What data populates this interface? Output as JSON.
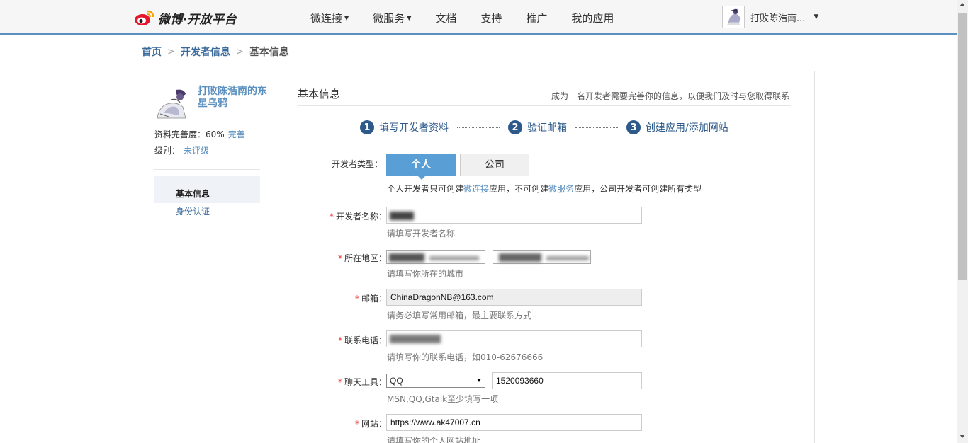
{
  "header": {
    "logo_text": "微博·开放平台",
    "nav": [
      {
        "label": "微连接",
        "dropdown": true
      },
      {
        "label": "微服务",
        "dropdown": true
      },
      {
        "label": "文档",
        "dropdown": false
      },
      {
        "label": "支持",
        "dropdown": false
      },
      {
        "label": "推广",
        "dropdown": false
      },
      {
        "label": "我的应用",
        "dropdown": false
      }
    ],
    "user_name": "打败陈浩南..."
  },
  "breadcrumb": [
    "首页",
    "开发者信息",
    "基本信息"
  ],
  "sidebar": {
    "name": "打败陈浩南的东星乌鸦",
    "completeness_label": "资料完善度：",
    "completeness_value": "60%",
    "completeness_link": "完善",
    "level_label": "级别：",
    "level_value": "未评级",
    "menu": [
      "基本信息",
      "身份认证"
    ]
  },
  "panel": {
    "title": "基本信息",
    "tip": "成为一名开发者需要完善你的信息，以便我们及时与您取得联系",
    "steps": [
      {
        "num": "1",
        "label": "填写开发者资料"
      },
      {
        "num": "2",
        "label": "验证邮箱"
      },
      {
        "num": "3",
        "label": "创建应用/添加网站"
      }
    ]
  },
  "form": {
    "type_label": "开发者类型：",
    "type_person": "个人",
    "type_company": "公司",
    "type_hint_1": "个人开发者只可创建",
    "type_hint_link1": "微连接",
    "type_hint_2": "应用，不可创建",
    "type_hint_link2": "微服务",
    "type_hint_3": "应用，公司开发者可创建所有类型",
    "name_label": "开发者名称：",
    "name_hint": "请填写开发者名称",
    "region_label": "所在地区：",
    "region_hint": "请填写你所在的城市",
    "email_label": "邮箱：",
    "email_value": "ChinaDragonNB@163.com",
    "email_hint": "请务必填写常用邮箱，最主要联系方式",
    "phone_label": "联系电话：",
    "phone_hint": "请填写你的联系电话，如010-62676666",
    "chat_label": "聊天工具：",
    "chat_type": "QQ",
    "chat_value": "1520093660",
    "chat_hint": "MSN,QQ,Gtalk至少填写一项",
    "site_label": "网站：",
    "site_value": "https://www.ak47007.cn",
    "site_hint": "请填写你的个人网站地址"
  },
  "colors": {
    "accent": "#5a8fbf",
    "tab_active": "#5a9ed6",
    "step": "#2d5a8a",
    "required": "#ee3333"
  }
}
